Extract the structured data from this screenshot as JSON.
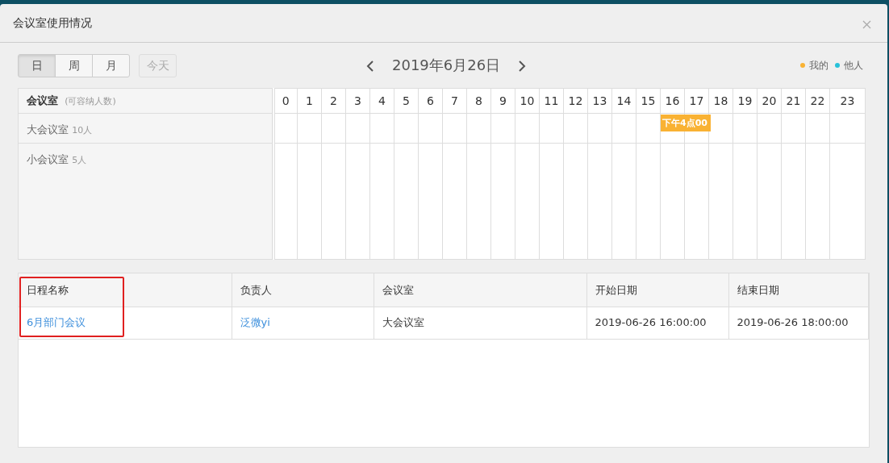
{
  "title": "会议室使用情况",
  "view_buttons": [
    {
      "label": "日",
      "selected": true
    },
    {
      "label": "周",
      "selected": false
    },
    {
      "label": "月",
      "selected": false
    }
  ],
  "today_button": {
    "label": "今天",
    "disabled": true
  },
  "date": "2019年6月26日",
  "legend": [
    {
      "label": "我的",
      "color": "#f9b233"
    },
    {
      "label": "他人",
      "color": "#27c1d9"
    }
  ],
  "schedule": {
    "header_label": "会议室",
    "header_hint": "(可容纳人数)",
    "hours": [
      "0",
      "1",
      "2",
      "3",
      "4",
      "5",
      "6",
      "7",
      "8",
      "9",
      "10",
      "11",
      "12",
      "13",
      "14",
      "15",
      "16",
      "17",
      "18",
      "19",
      "20",
      "21",
      "22",
      "23"
    ],
    "rooms": [
      {
        "name": "大会议室",
        "capacity": "10人",
        "slots": [
          {
            "booked": false
          },
          {
            "booked": false
          },
          {
            "booked": false
          },
          {
            "booked": false
          },
          {
            "booked": false
          },
          {
            "booked": false
          },
          {
            "booked": false
          },
          {
            "booked": false
          },
          {
            "booked": false
          },
          {
            "booked": false
          },
          {
            "booked": false
          },
          {
            "booked": false
          },
          {
            "booked": false
          },
          {
            "booked": false
          },
          {
            "booked": false
          },
          {
            "booked": false
          },
          {
            "booked": true,
            "label": "下午4点00",
            "color": "#f9b233"
          },
          {
            "booked": true
          },
          {
            "booked": false
          },
          {
            "booked": false
          },
          {
            "booked": false
          },
          {
            "booked": false
          },
          {
            "booked": false
          },
          {
            "booked": false
          }
        ]
      },
      {
        "name": "小会议室",
        "capacity": "5人",
        "slots": [
          {
            "booked": false
          },
          {
            "booked": false
          },
          {
            "booked": false
          },
          {
            "booked": false
          },
          {
            "booked": false
          },
          {
            "booked": false
          },
          {
            "booked": false
          },
          {
            "booked": false
          },
          {
            "booked": false
          },
          {
            "booked": false
          },
          {
            "booked": false
          },
          {
            "booked": false
          },
          {
            "booked": false
          },
          {
            "booked": false
          },
          {
            "booked": false
          },
          {
            "booked": false
          },
          {
            "booked": false
          },
          {
            "booked": false
          },
          {
            "booked": false
          },
          {
            "booked": false
          },
          {
            "booked": false
          },
          {
            "booked": false
          },
          {
            "booked": false
          },
          {
            "booked": false
          }
        ]
      }
    ]
  },
  "table": {
    "columns": [
      {
        "label": "日程名称",
        "highlighted": true
      },
      {
        "label": "负责人",
        "highlighted": false
      },
      {
        "label": "会议室",
        "highlighted": false
      },
      {
        "label": "开始日期",
        "highlighted": false
      },
      {
        "label": "结束日期",
        "highlighted": false
      }
    ],
    "rows": [
      {
        "cells": [
          {
            "text": "6月部门会议",
            "kind": "link"
          },
          {
            "text": "泛微yi",
            "kind": "link"
          },
          {
            "text": "大会议室",
            "kind": "text"
          },
          {
            "text": "2019-06-26 16:00:00",
            "kind": "text"
          },
          {
            "text": "2019-06-26 18:00:00",
            "kind": "text"
          }
        ]
      }
    ]
  }
}
